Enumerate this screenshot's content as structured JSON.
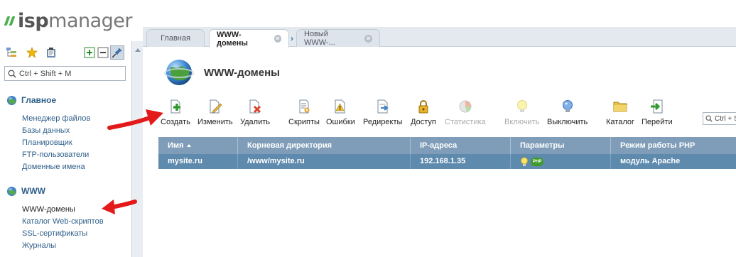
{
  "logo": {
    "part1": "isp",
    "part2": "manager"
  },
  "sidebar": {
    "search_placeholder": "Ctrl + Shift + M",
    "groups": [
      {
        "title": "Главное",
        "items": [
          "Менеджер файлов",
          "Базы данных",
          "Планировщик",
          "FTP-пользователи",
          "Доменные имена"
        ]
      },
      {
        "title": "WWW",
        "items": [
          "WWW-домены",
          "Каталог Web-скриптов",
          "SSL-сертификаты",
          "Журналы"
        ]
      }
    ]
  },
  "tabs": [
    {
      "label": "Главная"
    },
    {
      "label": "WWW-домены",
      "active": true
    },
    {
      "label": "Новый WWW-..."
    }
  ],
  "page": {
    "title": "WWW-домены"
  },
  "toolbar": {
    "buttons": [
      {
        "label": "Создать",
        "icon": "create-icon"
      },
      {
        "label": "Изменить",
        "icon": "edit-icon"
      },
      {
        "label": "Удалить",
        "icon": "delete-icon"
      },
      {
        "label": "Скрипты",
        "icon": "scripts-icon"
      },
      {
        "label": "Ошибки",
        "icon": "errors-icon"
      },
      {
        "label": "Редиректы",
        "icon": "redirects-icon"
      },
      {
        "label": "Доступ",
        "icon": "lock-icon"
      },
      {
        "label": "Статистика",
        "icon": "statistics-icon",
        "disabled": true
      },
      {
        "label": "Включить",
        "icon": "bulb-on-icon",
        "disabled": true
      },
      {
        "label": "Выключить",
        "icon": "bulb-off-icon"
      },
      {
        "label": "Каталог",
        "icon": "folder-icon"
      },
      {
        "label": "Перейти",
        "icon": "goto-icon"
      }
    ],
    "search_placeholder": "Ctrl + Shi"
  },
  "table": {
    "columns": [
      "Имя",
      "Корневая директория",
      "IP-адреса",
      "Параметры",
      "Режим работы PHP"
    ],
    "rows": [
      {
        "name": "mysite.ru",
        "root": "/www/mysite.ru",
        "ip": "192.168.1.35",
        "php_badge": "PHP",
        "php_mode": "модуль Apache"
      }
    ]
  },
  "colors": {
    "accent": "#2e5f8a",
    "header": "#7f9db8",
    "selected_row": "#5e8aad",
    "logo_green": "#4caf50",
    "annotation_red": "#e31a1a"
  }
}
